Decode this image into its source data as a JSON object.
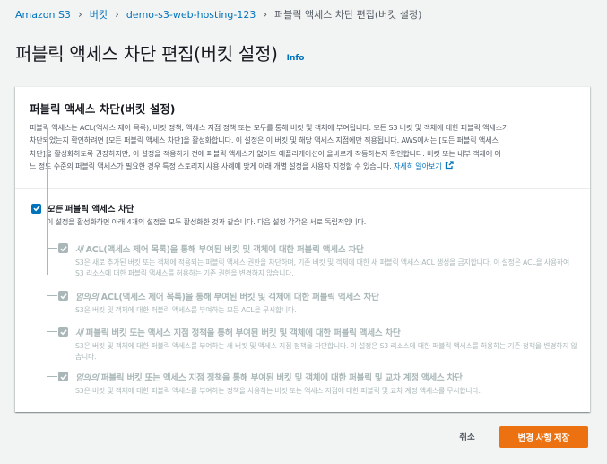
{
  "breadcrumb": {
    "items": [
      "Amazon S3",
      "버킷",
      "demo-s3-web-hosting-123",
      "퍼블릭 액세스 차단 편집(버킷 설정)"
    ]
  },
  "page": {
    "title": "퍼블릭 액세스 차단 편집(버킷 설정)",
    "info": "Info"
  },
  "panel": {
    "title": "퍼블릭 액세스 차단(버킷 설정)",
    "description_lines": [
      "퍼블릭 액세스는 ACL(액세스 제어 목록), 버킷 정책, 액세스 지점 정책 또는 모두를 통해 버킷 및 객체에 부여됩니다. 모든 S3 버킷 및 객체에 대한 퍼블릭 액세스가",
      "차단되었는지 확인하려면 [모든 퍼블릭 액세스 차단]을 활성화합니다. 이 설정은 이 버킷 및 해당 액세스 지점에만 적용됩니다. AWS에서는 [모든 퍼블릭 액세스",
      "차단]을 활성화하도록 권장하지만, 이 설정을 적용하기 전에 퍼블릭 액세스가 없어도 애플리케이션이 올바르게 작동하는지 확인합니다. 버킷 또는 내부 객체에 어",
      "느 정도 수준의 퍼블릭 액세스가 필요한 경우 특정 스토리지 사용 사례에 맞게 아래 개별 설정을 사용자 지정할 수 있습니다."
    ],
    "learn_more": "자세히 알아보기"
  },
  "block_all": {
    "label_em": "모든",
    "label_rest": " 퍼블릭 액세스 차단",
    "description": "이 설정을 활성화하면 아래 4개의 설정을 모두 활성화한 것과 같습니다. 다음 설정 각각은 서로 독립적입니다.",
    "checked": true
  },
  "options": [
    {
      "title_em": "새",
      "title_rest": " ACL(액세스 제어 목록)을 통해 부여된 버킷 및 객체에 대한 퍼블릭 액세스 차단",
      "description": "S3은 새로 추가된 버킷 또는 객체에 적용되는 퍼블릭 액세스 권한을 차단하며, 기존 버킷 및 객체에 대한 새 퍼블릭 액세스 ACL 생성을 금지합니다. 이 설정은 ACL을 사용하여 S3 리소스에 대한 퍼블릭 액세스를 허용하는 기존 권한을 변경하지 않습니다.",
      "checked": true
    },
    {
      "title_em": "임의의",
      "title_rest": " ACL(액세스 제어 목록)을 통해 부여된 버킷 및 객체에 대한 퍼블릭 액세스 차단",
      "description": "S3은 버킷 및 객체에 대한 퍼블릭 액세스를 부여하는 모든 ACL을 무시합니다.",
      "checked": true
    },
    {
      "title_em": "새",
      "title_rest": " 퍼블릭 버킷 또는 액세스 지점 정책을 통해 부여된 버킷 및 객체에 대한 퍼블릭 액세스 차단",
      "description": "S3은 버킷 및 객체에 대한 퍼블릭 액세스를 부여하는 새 버킷 및 액세스 지점 정책을 차단합니다. 이 설정은 S3 리소스에 대한 퍼블릭 액세스를 허용하는 기존 정책을 변경하지 않습니다.",
      "checked": true
    },
    {
      "title_em": "임의의",
      "title_rest": " 퍼블릭 버킷 또는 액세스 지점 정책을 통해 부여된 버킷 및 객체에 대한 퍼블릭 및 교차 계정 액세스 차단",
      "description": "S3은 버킷 및 객체에 대한 퍼블릭 액세스를 부여하는 정책을 사용하는 버킷 또는 액세스 지점에 대한 퍼블릭 및 교차 계정 액세스를 무시합니다.",
      "checked": true
    }
  ],
  "footer": {
    "cancel": "취소",
    "save": "변경 사항 저장"
  },
  "colors": {
    "link": "#0073bb",
    "primary_button": "#ec7211",
    "checkbox_checked": "#0073bb",
    "checkbox_disabled": "#aab7b8"
  }
}
